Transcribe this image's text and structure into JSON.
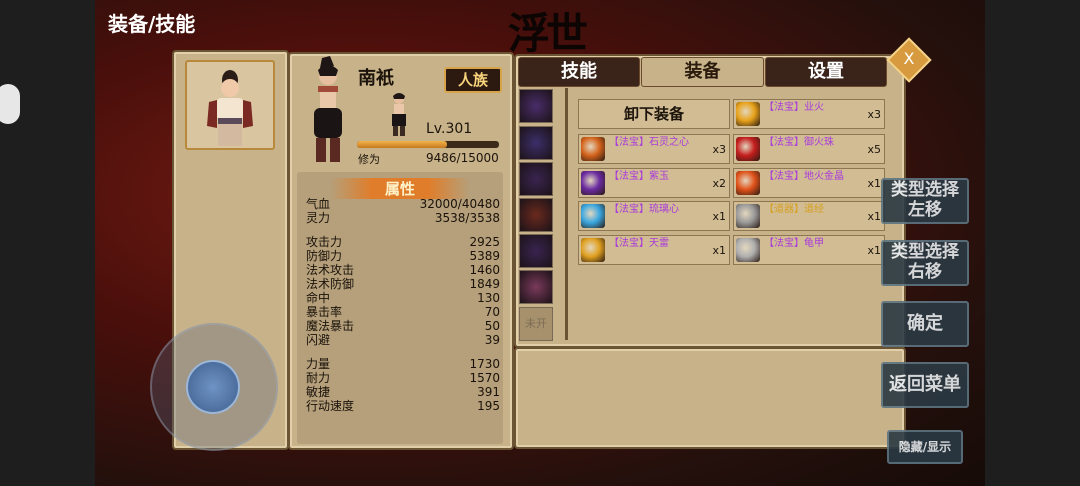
{
  "page_title": "装备/技能",
  "character": {
    "name": "南衹",
    "race": "人族",
    "level": "Lv.301",
    "xp_label": "修为",
    "xp_value": "9486/15000",
    "xp_fraction": 0.632
  },
  "stats": {
    "title": "属性",
    "rows": [
      {
        "label": "气血",
        "value": "32000/40480"
      },
      {
        "label": "灵力",
        "value": "3538/3538"
      },
      {
        "label": "攻击力",
        "value": "2925"
      },
      {
        "label": "防御力",
        "value": "5389"
      },
      {
        "label": "法术攻击",
        "value": "1460"
      },
      {
        "label": "法术防御",
        "value": "1849"
      },
      {
        "label": "命中",
        "value": "130"
      },
      {
        "label": "暴击率",
        "value": "70"
      },
      {
        "label": "魔法暴击",
        "value": "50"
      },
      {
        "label": "闪避",
        "value": "39"
      },
      {
        "label": "力量",
        "value": "1730"
      },
      {
        "label": "耐力",
        "value": "1570"
      },
      {
        "label": "敏捷",
        "value": "391"
      },
      {
        "label": "行动速度",
        "value": "195"
      }
    ]
  },
  "tabs": [
    {
      "label": "技能",
      "active": false
    },
    {
      "label": "装备",
      "active": true
    },
    {
      "label": "设置",
      "active": false
    }
  ],
  "close_label": "X",
  "slot_locked_label": "未开",
  "unequip_label": "卸下装备",
  "items": [
    {
      "name": "【法宝】业火",
      "qty": "x3",
      "icon": "fire-orb-icon",
      "color": "#e8a21a"
    },
    {
      "name": "【法宝】石灵之心",
      "qty": "x3",
      "icon": "stone-heart-icon",
      "color": "#d4631c"
    },
    {
      "name": "【法宝】御火珠",
      "qty": "x5",
      "icon": "red-pearl-icon",
      "color": "#c41e1e"
    },
    {
      "name": "【法宝】紫玉",
      "qty": "x2",
      "icon": "purple-jade-icon",
      "color": "#6a2aa0"
    },
    {
      "name": "【法宝】地火金晶",
      "qty": "x1",
      "icon": "fire-crystal-icon",
      "color": "#e0521a"
    },
    {
      "name": "【法宝】琉璃心",
      "qty": "x1",
      "icon": "glass-heart-icon",
      "color": "#3aa7e0"
    },
    {
      "name": "【道器】道经",
      "qty": "x1",
      "icon": "scroll-icon",
      "color": "#9a9a9a",
      "quality": "dao"
    },
    {
      "name": "【法宝】天雷",
      "qty": "x1",
      "icon": "thunder-icon",
      "color": "#e0a020"
    },
    {
      "name": "【法宝】龟甲",
      "qty": "x1",
      "icon": "tortoise-shell-icon",
      "color": "#b0b0b0"
    }
  ],
  "side_buttons": {
    "type_left": "类型选择左移",
    "type_right": "类型选择右移",
    "confirm": "确定",
    "return_menu": "返回菜单",
    "hide_show": "隐藏/显示"
  }
}
